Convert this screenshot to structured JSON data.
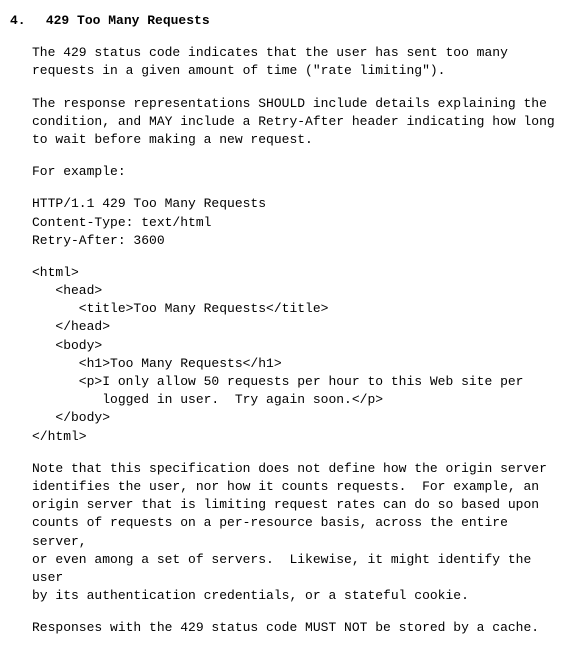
{
  "section": {
    "number": "4.",
    "title": "429 Too Many Requests"
  },
  "paragraphs": {
    "p1": "The 429 status code indicates that the user has sent too many\nrequests in a given amount of time (\"rate limiting\").",
    "p2": "The response representations SHOULD include details explaining the\ncondition, and MAY include a Retry-After header indicating how long\nto wait before making a new request.",
    "p3": "For example:",
    "p4": "Note that this specification does not define how the origin server\nidentifies the user, nor how it counts requests.  For example, an\norigin server that is limiting request rates can do so based upon\ncounts of requests on a per-resource basis, across the entire server,\nor even among a set of servers.  Likewise, it might identify the user\nby its authentication credentials, or a stateful cookie.",
    "p5": "Responses with the 429 status code MUST NOT be stored by a cache."
  },
  "code": {
    "http": "HTTP/1.1 429 Too Many Requests\nContent-Type: text/html\nRetry-After: 3600",
    "html": "<html>\n   <head>\n      <title>Too Many Requests</title>\n   </head>\n   <body>\n      <h1>Too Many Requests</h1>\n      <p>I only allow 50 requests per hour to this Web site per\n         logged in user.  Try again soon.</p>\n   </body>\n</html>"
  }
}
